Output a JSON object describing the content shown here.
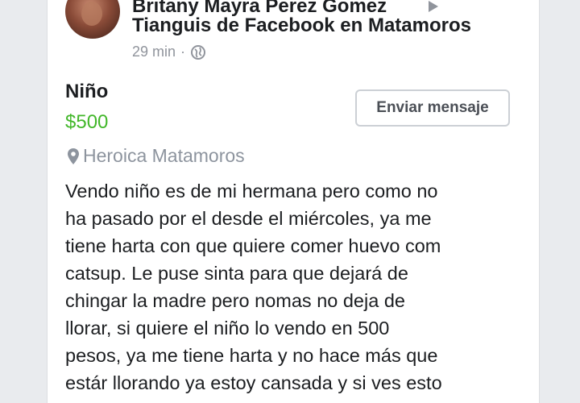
{
  "post": {
    "author": "Britany Mayra Perez Gomez",
    "group": "Tianguis de Facebook en Matamoros",
    "time": "29 min",
    "separator": "·",
    "privacy_icon": "globe-icon"
  },
  "listing": {
    "title": "Niño",
    "price": "$500",
    "location": "Heroica Matamoros",
    "message_button": "Enviar mensaje"
  },
  "description_lines": [
    "Vendo niño es de mi hermana pero como no",
    "ha pasado por el desde el miércoles, ya me",
    "tiene harta con que quiere comer huevo com",
    "catsup. Le puse sinta para que dejará de",
    "chingar la madre pero nomas no deja de",
    "llorar, si quiere el niño lo vendo en 500",
    "pesos, ya me tiene harta y no hace más que",
    "estár llorando ya estoy cansada y si ves esto"
  ],
  "colors": {
    "price": "#42b72a",
    "text": "#1c1e21",
    "muted": "#90949c",
    "background": "#e9ebee"
  }
}
